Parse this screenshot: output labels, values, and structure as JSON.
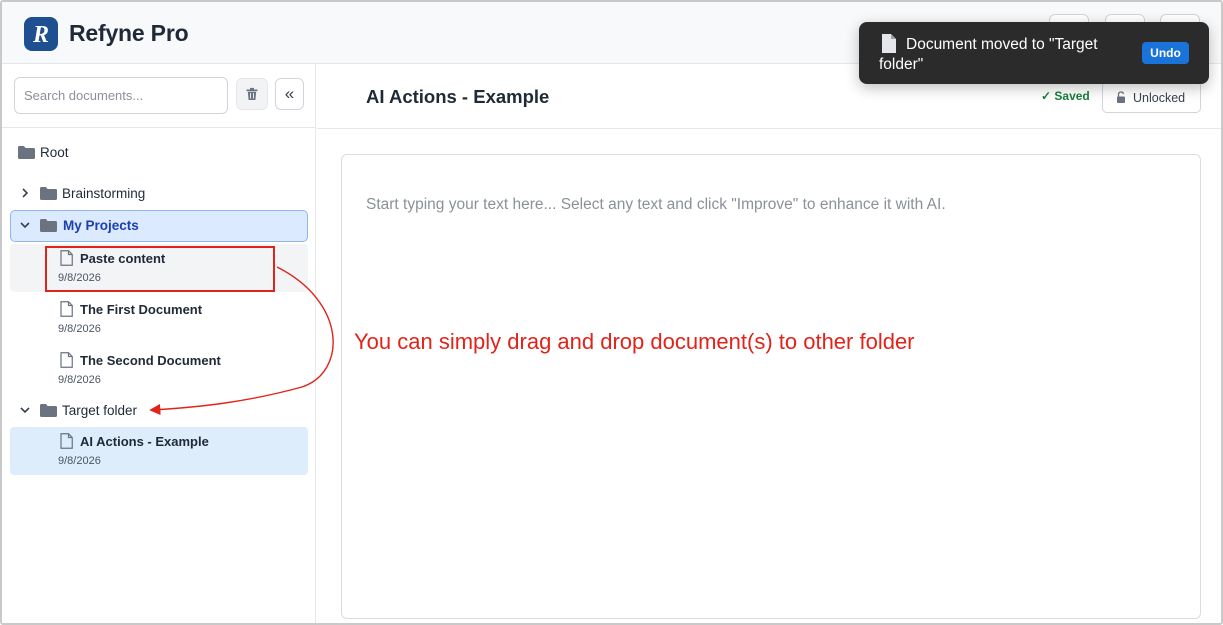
{
  "app": {
    "title": "Refyne Pro",
    "logo_letter": "R"
  },
  "toast": {
    "message": "Document moved to \"Target folder\"",
    "action_label": "Undo"
  },
  "sidebar": {
    "search_placeholder": "Search documents...",
    "trash_icon": "trash-icon",
    "collapse_label": "«",
    "root_label": "Root",
    "folders": [
      {
        "label": "Brainstorming",
        "expanded": false
      },
      {
        "label": "My Projects",
        "expanded": true,
        "selected": true
      },
      {
        "label": "Target folder",
        "expanded": true
      }
    ],
    "my_projects_docs": [
      {
        "title": "Paste content",
        "date": "9/8/2026"
      },
      {
        "title": "The First Document",
        "date": "9/8/2026"
      },
      {
        "title": "The Second Document",
        "date": "9/8/2026"
      }
    ],
    "target_docs": [
      {
        "title": "AI Actions - Example",
        "date": "9/8/2026",
        "active": true
      }
    ]
  },
  "editor": {
    "document_title": "AI Actions - Example",
    "saved_label": "✓ Saved",
    "lock_label": "Unlocked",
    "placeholder": "Start typing your text here... Select any text and click \"Improve\" to enhance it with AI."
  },
  "annotation": {
    "text": "You can simply drag and drop document(s) to other folder",
    "color": "#e2231a"
  },
  "colors": {
    "accent": "#1a73d9",
    "brand": "#1d4f91",
    "saved": "#16803c",
    "selection": "#dbeafe"
  }
}
